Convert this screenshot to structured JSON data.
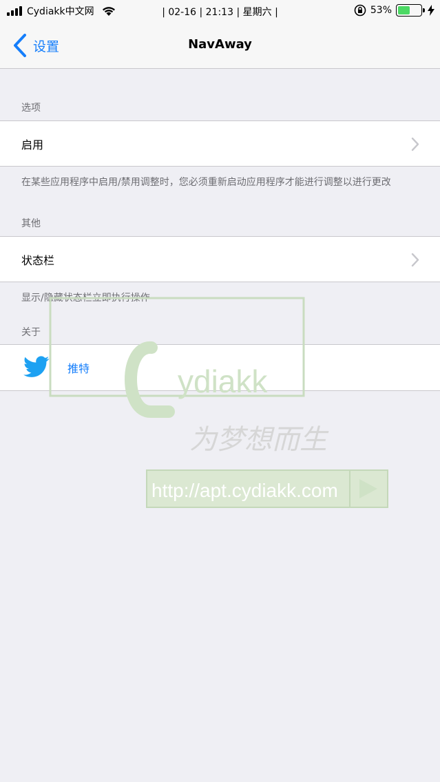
{
  "status_bar": {
    "carrier": "Cydiakk中文网",
    "center_text": "| 02-16 | 21:13 | 星期六 |",
    "battery_percent": "53%",
    "battery_level": 0.53
  },
  "nav": {
    "back_label": "设置",
    "title": "NavAway"
  },
  "sections": {
    "options": {
      "header": "选项",
      "cell_label": "启用",
      "footer": "在某些应用程序中启用/禁用调整时，您必须重新启动应用程序才能进行调整以进行更改"
    },
    "other": {
      "header": "其他",
      "cell_label": "状态栏",
      "footer": "显示/隐藏状态栏立即执行操作"
    },
    "about": {
      "header": "关于",
      "cell_label": "推特"
    }
  },
  "watermark": {
    "logo_text": "ydiakk",
    "slogan": "为梦想而生",
    "url": "http://apt.cydiakk.com"
  },
  "colors": {
    "accent": "#157efb",
    "background": "#efeff4",
    "battery": "#4cd964"
  }
}
